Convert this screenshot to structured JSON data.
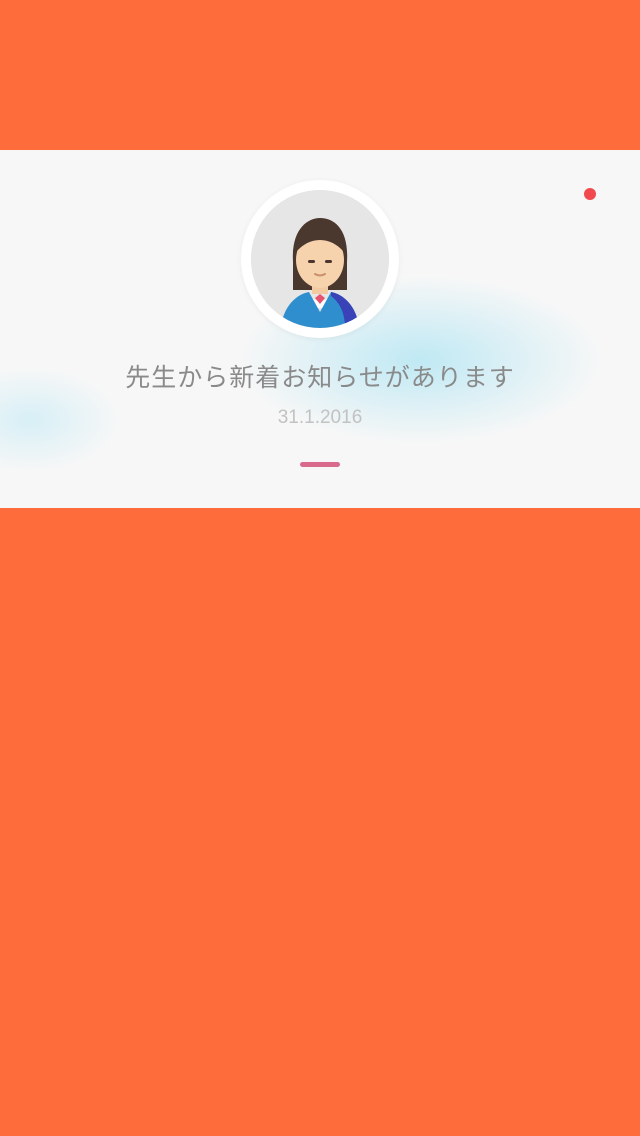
{
  "notification": {
    "title": "先生から新着お知らせがあります",
    "date": "31.1.2016",
    "unread": true,
    "avatar_icon": "teacher-avatar-icon"
  },
  "colors": {
    "background": "#ff6c3b",
    "card": "#f7f7f7",
    "unread_dot": "#f2494f",
    "indicator": "#d96a8c"
  }
}
